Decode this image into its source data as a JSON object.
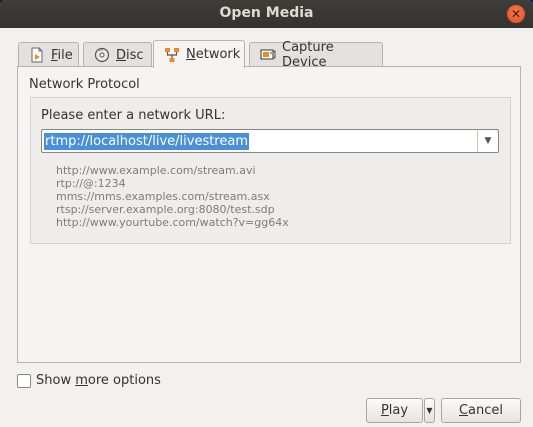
{
  "window": {
    "title": "Open Media",
    "close_glyph": "✕"
  },
  "tabs": [
    {
      "mnemonic": "F",
      "rest": "ile",
      "icon": "file-icon"
    },
    {
      "mnemonic": "D",
      "rest": "isc",
      "icon": "disc-icon"
    },
    {
      "mnemonic": "N",
      "rest": "etwork",
      "icon": "network-icon",
      "active": true
    },
    {
      "before": "Capture ",
      "mnemonic": "D",
      "rest": "evice",
      "icon": "capture-device-icon"
    }
  ],
  "network": {
    "group_title": "Network Protocol",
    "url_label": "Please enter a network URL:",
    "url_value": "rtmp://localhost/live/livestream",
    "examples": [
      "http://www.example.com/stream.avi",
      "rtp://@:1234",
      "mms://mms.examples.com/stream.asx",
      "rtsp://server.example.org:8080/test.sdp",
      "http://www.yourtube.com/watch?v=gg64x"
    ]
  },
  "options": {
    "before": "Show ",
    "mnemonic": "m",
    "rest": "ore options",
    "checked": false
  },
  "buttons": {
    "play": {
      "mnemonic": "P",
      "rest": "lay"
    },
    "cancel": {
      "mnemonic": "C",
      "rest": "ancel"
    }
  },
  "colors": {
    "selection": "#4a90d9",
    "titlebar": "#3c3b37",
    "close": "#e9541f"
  }
}
